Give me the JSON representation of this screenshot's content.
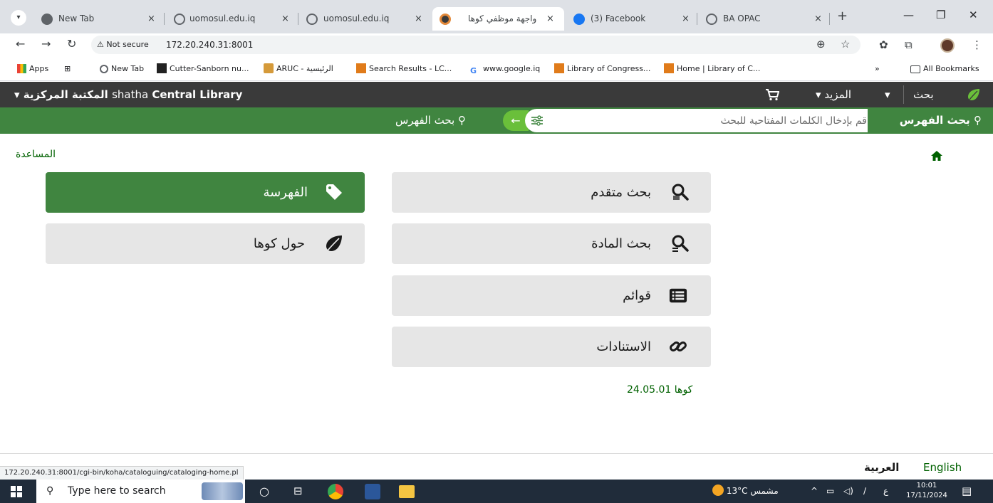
{
  "browser": {
    "tabs": [
      {
        "title": "New Tab",
        "close": "×"
      },
      {
        "title": "uomosul.edu.iq",
        "close": "×"
      },
      {
        "title": "uomosul.edu.iq",
        "close": "×"
      },
      {
        "title": "واجهة موظفي كوها",
        "close": "×"
      },
      {
        "title": "(3) Facebook",
        "close": "×"
      },
      {
        "title": "BA OPAC",
        "close": "×"
      }
    ],
    "new_tab": "+",
    "security_label": "Not secure",
    "url": "172.20.240.31:8001",
    "bookmarks": [
      {
        "label": "Apps"
      },
      {
        "label": "New Tab"
      },
      {
        "label": "Cutter-Sanborn nu..."
      },
      {
        "label": "ARUC - الرئيسية"
      },
      {
        "label": "Search Results - LC..."
      },
      {
        "label": "www.google.iq"
      },
      {
        "label": "Library of Congress..."
      },
      {
        "label": "Home | Library of C..."
      }
    ],
    "bookmarks_more": "»",
    "all_bookmarks": "All Bookmarks",
    "status_url": "172.20.240.31:8001/cgi-bin/koha/cataloguing/cataloging-home.pl"
  },
  "koha": {
    "library_prefix": "shatha",
    "library_name_en": "Central Library",
    "library_name_ar": "المكتبة المركزية",
    "nav_search": "بحث",
    "nav_more": "المزيد",
    "caret": "▾",
    "cart_icon": "cart-icon",
    "search_label": "بحث الفهرس",
    "search_placeholder": "قم بإدخال الكلمات المفتاحية للبحث",
    "catalog_search_link": "بحث الفهرس",
    "help": "المساعدة",
    "tiles_right": [
      {
        "label": "بحث متقدم",
        "icon": "advanced-search-icon"
      },
      {
        "label": "بحث المادة",
        "icon": "item-search-icon"
      },
      {
        "label": "قوائم",
        "icon": "lists-icon"
      },
      {
        "label": "الاستنادات",
        "icon": "authorities-icon"
      }
    ],
    "tiles_left": [
      {
        "label": "الفهرسة",
        "icon": "tag-icon",
        "active": true
      },
      {
        "label": "حول كوها",
        "icon": "koha-leaf-icon"
      }
    ],
    "version": "كوها 24.05.01",
    "languages": {
      "ar": "العربية",
      "en": "English"
    },
    "colors": {
      "brand_green": "#408540",
      "dark_header": "#3a3a3a",
      "tile_gray": "#e6e6e6",
      "link_green": "#006100"
    }
  },
  "taskbar": {
    "search_placeholder": "Type here to search",
    "weather_temp": "13°C",
    "weather_text": "مشمس",
    "input_lang": "ع",
    "time": "10:01",
    "date": "17/11/2024"
  }
}
